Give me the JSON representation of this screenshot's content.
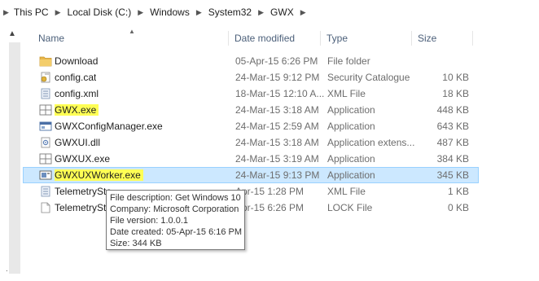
{
  "breadcrumb": [
    "This PC",
    "Local Disk (C:)",
    "Windows",
    "System32",
    "GWX"
  ],
  "columns": {
    "name": "Name",
    "date": "Date modified",
    "type": "Type",
    "size": "Size"
  },
  "files": [
    {
      "name": "Download",
      "date": "05-Apr-15 6:26 PM",
      "type": "File folder",
      "size": "",
      "icon": "folder-icon",
      "highlight": false,
      "selected": false
    },
    {
      "name": "config.cat",
      "date": "24-Mar-15 9:12 PM",
      "type": "Security Catalogue",
      "size": "10 KB",
      "icon": "catalog-file-icon",
      "highlight": false,
      "selected": false
    },
    {
      "name": "config.xml",
      "date": "18-Mar-15 12:10 A...",
      "type": "XML File",
      "size": "18 KB",
      "icon": "xml-file-icon",
      "highlight": false,
      "selected": false
    },
    {
      "name": "GWX.exe",
      "date": "24-Mar-15 3:18 AM",
      "type": "Application",
      "size": "448 KB",
      "icon": "app-icon",
      "highlight": true,
      "selected": false
    },
    {
      "name": "GWXConfigManager.exe",
      "date": "24-Mar-15 2:59 AM",
      "type": "Application",
      "size": "643 KB",
      "icon": "window-app-icon",
      "highlight": false,
      "selected": false
    },
    {
      "name": "GWXUI.dll",
      "date": "24-Mar-15 3:18 AM",
      "type": "Application extens...",
      "size": "487 KB",
      "icon": "dll-icon",
      "highlight": false,
      "selected": false
    },
    {
      "name": "GWXUX.exe",
      "date": "24-Mar-15 3:19 AM",
      "type": "Application",
      "size": "384 KB",
      "icon": "app-icon",
      "highlight": false,
      "selected": false
    },
    {
      "name": "GWXUXWorker.exe",
      "date": "24-Mar-15 9:13 PM",
      "type": "Application",
      "size": "345 KB",
      "icon": "worker-app-icon",
      "highlight": true,
      "selected": true
    },
    {
      "name": "TelemetrySto...",
      "date": "Apr-15 1:28 PM",
      "type": "XML File",
      "size": "1 KB",
      "icon": "xml-file-icon",
      "highlight": false,
      "selected": false
    },
    {
      "name": "TelemetrySto...",
      "date": "Apr-15 6:26 PM",
      "type": "LOCK File",
      "size": "0 KB",
      "icon": "blank-file-icon",
      "highlight": false,
      "selected": false
    }
  ],
  "tooltip": [
    "File description: Get Windows 10",
    "Company: Microsoft Corporation",
    "File version: 1.0.0.1",
    "Date created: 05-Apr-15 6:16 PM",
    "Size: 344 KB"
  ],
  "colors": {
    "selection_bg": "#cce8ff",
    "selection_border": "#99d1ff",
    "highlight": "#ffff55",
    "header_text": "#4c607a"
  }
}
